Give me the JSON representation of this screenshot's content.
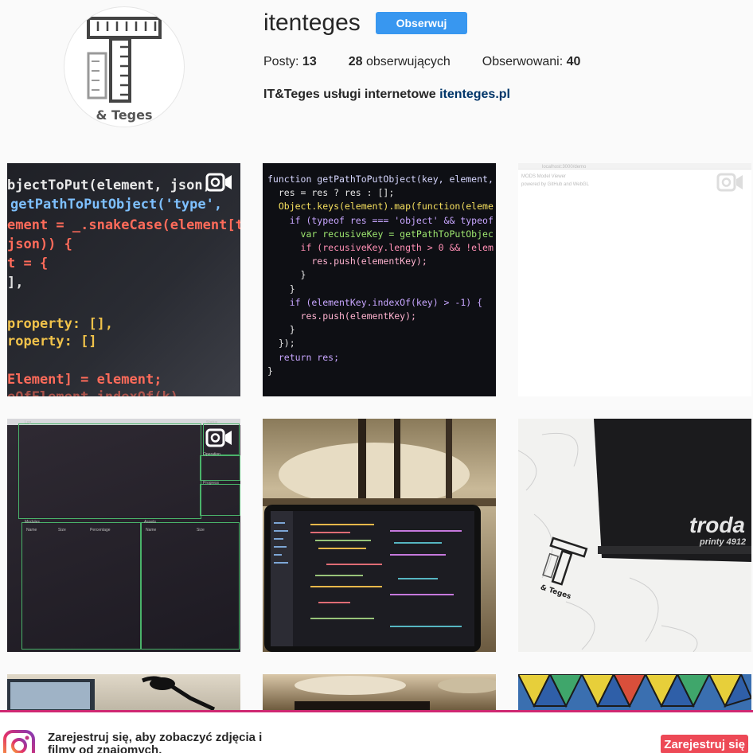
{
  "profile": {
    "username": "itenteges",
    "follow_label": "Obserwuj",
    "avatar_caption": "& Teges",
    "stats": {
      "posts_label": "Posty:",
      "posts_count": "13",
      "followers_count": "28",
      "followers_label": "obserwujących",
      "following_label": "Obserwowani:",
      "following_count": "40"
    },
    "bio_text": "IT&Teges usługi internetowe",
    "bio_link": "itenteges.pl"
  },
  "grid": {
    "tile1_lines": [
      "bjectToPut(element, json,",
      " getPathToPutObject('type',",
      "ement = _.snakeCase(element[t",
      "json)) {",
      "t = {",
      "],",
      "property: [],",
      "roperty: []",
      "Element] = element;",
      "eOfElement.indexOf(k) "
    ],
    "tile2_lines": [
      "function getPathToPutObject(key, element,",
      "  res = res ? res : [];",
      "  Object.keys(element).map(function(eleme",
      "    if (typeof res === 'object' && typeof",
      "      var recusiveKey = getPathToPutObjec",
      "      if (recusiveKey.length > 0 && !elem",
      "        res.push(elementKey);",
      "      }",
      "    }",
      "    if (elementKey.indexOf(key) > -1) {",
      "      res.push(elementKey);",
      "    }",
      "  });",
      "  return res;",
      "}"
    ],
    "tile3_lines": [
      "localhost:3000/demo",
      "MODS Model Viewer",
      "powered by GitHub and WebGL"
    ],
    "tile4_labels": [
      "Log",
      "Status",
      "Operation",
      "Progress",
      "Modules",
      "Name",
      "Size",
      "Percentage",
      "Assets",
      "Name",
      "Size"
    ],
    "tile6_brand": "troda",
    "tile6_model": "printy 4912",
    "tile6_stamp": "& Teges"
  },
  "signup": {
    "text": "Zarejestruj się, aby zobaczyć zdjęcia i filmy od znajomych.",
    "button_label": "Zarejestruj się"
  },
  "colors": {
    "follow_button": "#3897f0",
    "signup_button": "#ed4956",
    "banner_border": "#cf2872",
    "link": "#003569"
  }
}
